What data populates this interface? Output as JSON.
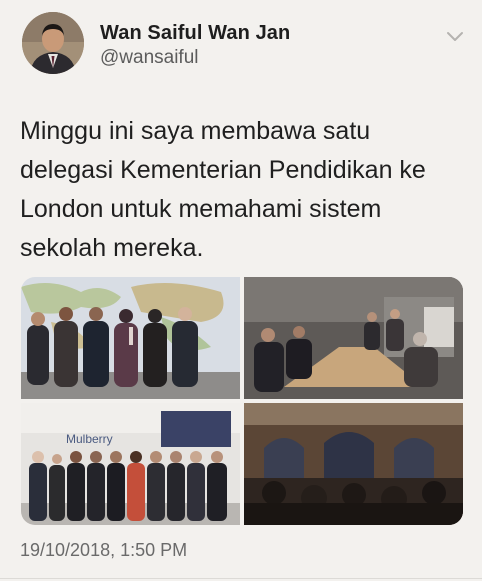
{
  "tweet": {
    "author_name": "Wan Saiful Wan Jan",
    "author_handle": "@wansaiful",
    "text": "Minggu ini saya membawa satu delegasi Kementerian Pendidikan ke London untuk memahami sistem sekolah mereka.",
    "timestamp": "19/10/2018, 1:50 PM",
    "photo_count": 4
  },
  "icons": {
    "menu": "chevron-down-icon"
  },
  "colors": {
    "background": "#f3f1ee",
    "name": "#1e1e1e",
    "handle": "#5c5c5c",
    "timestamp": "#6a6a6a"
  }
}
